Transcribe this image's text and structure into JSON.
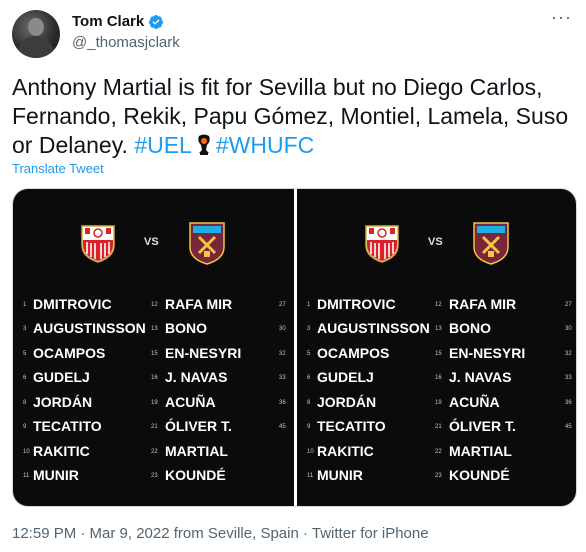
{
  "author": {
    "display_name": "Tom Clark",
    "handle": "@_thomasjclark",
    "verified": true
  },
  "tweet": {
    "text_part1": "Anthony Martial is fit for Sevilla but no Diego Carlos, Fernando, Rekik, Papu Gómez, Montiel, Lamela, Suso or Delaney. ",
    "hashtag1": "#UEL",
    "hashtag2": "#WHUFC",
    "translate_label": "Translate Tweet"
  },
  "media": {
    "vs_label": "VS",
    "sevilla_column": [
      {
        "num": "1",
        "name": "DMITROVIC"
      },
      {
        "num": "3",
        "name": "AUGUSTINSSON"
      },
      {
        "num": "5",
        "name": "OCAMPOS"
      },
      {
        "num": "6",
        "name": "GUDELJ"
      },
      {
        "num": "8",
        "name": "JORDÁN"
      },
      {
        "num": "9",
        "name": "TECATITO"
      },
      {
        "num": "10",
        "name": "RAKITIC"
      },
      {
        "num": "11",
        "name": "MUNIR"
      }
    ],
    "sevilla_column2": [
      {
        "num": "12",
        "name": "RAFA MIR"
      },
      {
        "num": "13",
        "name": "BONO"
      },
      {
        "num": "15",
        "name": "EN-NESYRI"
      },
      {
        "num": "16",
        "name": "J. NAVAS"
      },
      {
        "num": "19",
        "name": "ACUÑA"
      },
      {
        "num": "21",
        "name": "ÓLIVER T."
      },
      {
        "num": "22",
        "name": "MARTIAL"
      },
      {
        "num": "23",
        "name": "KOUNDÉ"
      }
    ],
    "edge_numbers": [
      "27",
      "30",
      "32",
      "33",
      "36",
      "45"
    ]
  },
  "footer": {
    "timestamp": "12:59 PM · Mar 9, 2022 from Seville, Spain · Twitter for iPhone"
  },
  "colors": {
    "link": "#1d9bf0",
    "secondary_text": "#536471",
    "panel_bg": "#0b0b0b",
    "accent_red": "#e02b20"
  }
}
